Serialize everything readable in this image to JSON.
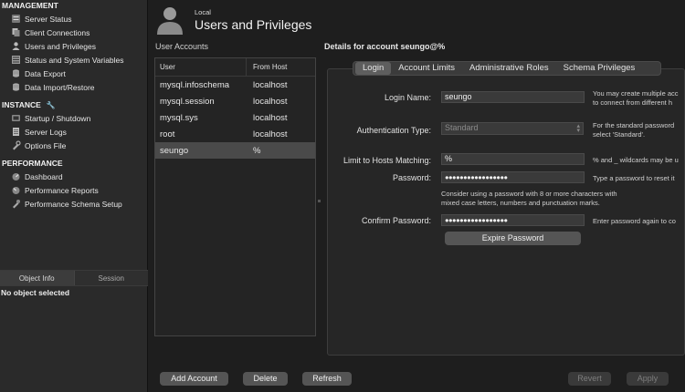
{
  "sidebar": {
    "management": {
      "heading": "MANAGEMENT",
      "items": [
        {
          "label": "Server Status",
          "icon": "server-status-icon"
        },
        {
          "label": "Client Connections",
          "icon": "client-connections-icon"
        },
        {
          "label": "Users and Privileges",
          "icon": "users-icon"
        },
        {
          "label": "Status and System Variables",
          "icon": "variables-icon"
        },
        {
          "label": "Data Export",
          "icon": "data-export-icon"
        },
        {
          "label": "Data Import/Restore",
          "icon": "data-import-icon"
        }
      ]
    },
    "instance": {
      "heading": "INSTANCE",
      "heading_icon": "wrench-icon",
      "items": [
        {
          "label": "Startup / Shutdown",
          "icon": "startup-icon"
        },
        {
          "label": "Server Logs",
          "icon": "server-logs-icon"
        },
        {
          "label": "Options File",
          "icon": "options-file-icon"
        }
      ]
    },
    "performance": {
      "heading": "PERFORMANCE",
      "items": [
        {
          "label": "Dashboard",
          "icon": "dashboard-icon"
        },
        {
          "label": "Performance Reports",
          "icon": "performance-reports-icon"
        },
        {
          "label": "Performance Schema Setup",
          "icon": "schema-setup-icon"
        }
      ]
    },
    "bottom_tabs": {
      "object_info": "Object Info",
      "session": "Session"
    },
    "no_object": "No object selected"
  },
  "header": {
    "sub": "Local",
    "title": "Users and Privileges"
  },
  "accounts": {
    "label": "User Accounts",
    "col_user": "User",
    "col_host": "From Host",
    "rows": [
      {
        "user": "mysql.infoschema",
        "host": "localhost"
      },
      {
        "user": "mysql.session",
        "host": "localhost"
      },
      {
        "user": "mysql.sys",
        "host": "localhost"
      },
      {
        "user": "root",
        "host": "localhost"
      },
      {
        "user": "seungo",
        "host": "%"
      }
    ],
    "selected_index": 4
  },
  "details": {
    "title": "Details for account seungo@%",
    "tabs": [
      "Login",
      "Account Limits",
      "Administrative Roles",
      "Schema Privileges"
    ],
    "active_tab": "Login",
    "login_name": {
      "label": "Login Name:",
      "value": "seungo",
      "help": [
        "You may create multiple acc",
        "to connect from different h"
      ]
    },
    "auth_type": {
      "label": "Authentication Type:",
      "value": "Standard",
      "help": [
        "For the standard password",
        "select 'Standard'."
      ]
    },
    "hosts": {
      "label": "Limit to Hosts Matching:",
      "value": "%",
      "help": "% and _ wildcards may be u"
    },
    "password": {
      "label": "Password:",
      "value": "●●●●●●●●●●●●●●●●●",
      "help": "Type a password to reset it"
    },
    "password_hint": [
      "Consider using a password with 8 or more characters with",
      "mixed case letters, numbers and punctuation marks."
    ],
    "confirm": {
      "label": "Confirm Password:",
      "value": "●●●●●●●●●●●●●●●●●",
      "help": "Enter password again to co"
    },
    "expire_button": "Expire Password"
  },
  "footer": {
    "add": "Add Account",
    "delete": "Delete",
    "refresh": "Refresh",
    "revert": "Revert",
    "apply": "Apply"
  }
}
